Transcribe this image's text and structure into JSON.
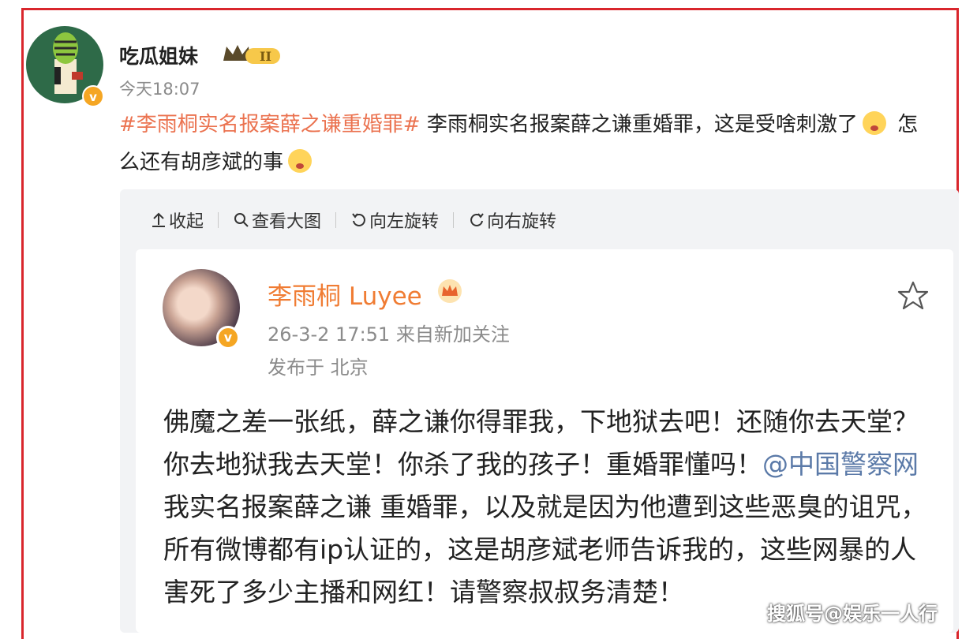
{
  "post": {
    "author": "吃瓜姐妹",
    "time": "今天18:07",
    "hashtag": "#李雨桐实名报案薛之谦重婚罪#",
    "text_a": " 李雨桐实名报案薛之谦重婚罪，这是受啥刺激了",
    "text_b": " 怎",
    "text_c": "么还有胡彦斌的事"
  },
  "toolbar": {
    "collapse": "收起",
    "view_large": "查看大图",
    "rotate_left": "向左旋转",
    "rotate_right": "向右旋转"
  },
  "quoted": {
    "author": "李雨桐 Luyee",
    "meta": "26-3-2 17:51  来自新加关注",
    "location": "发布于 北京",
    "body_a": "佛魔之差一张纸，薛之谦你得罪我，下地狱去吧！还随你去天堂？你去地狱我去天堂！你杀了我的孩子！重婚罪懂吗！",
    "mention": "@中国警察网",
    "body_b": " 我实名报案薛之谦 重婚罪，以及就是因为他遭到这些恶臭的诅咒，所有微博都有ip认证的，这是胡彦斌老师告诉我的，这些网暴的人害死了多少主播和网红！请警察叔叔务清楚！"
  },
  "watermark": "搜狐号@娱乐一人行",
  "colors": {
    "accent_orange": "#eb7350",
    "frame_red": "#d9262c",
    "mention_blue": "#5b7aa8"
  },
  "icons": [
    "verified-badge-icon",
    "crown-level-icon",
    "upload-icon",
    "search-icon",
    "rotate-left-icon",
    "rotate-right-icon",
    "star-icon",
    "emoji-icon"
  ]
}
